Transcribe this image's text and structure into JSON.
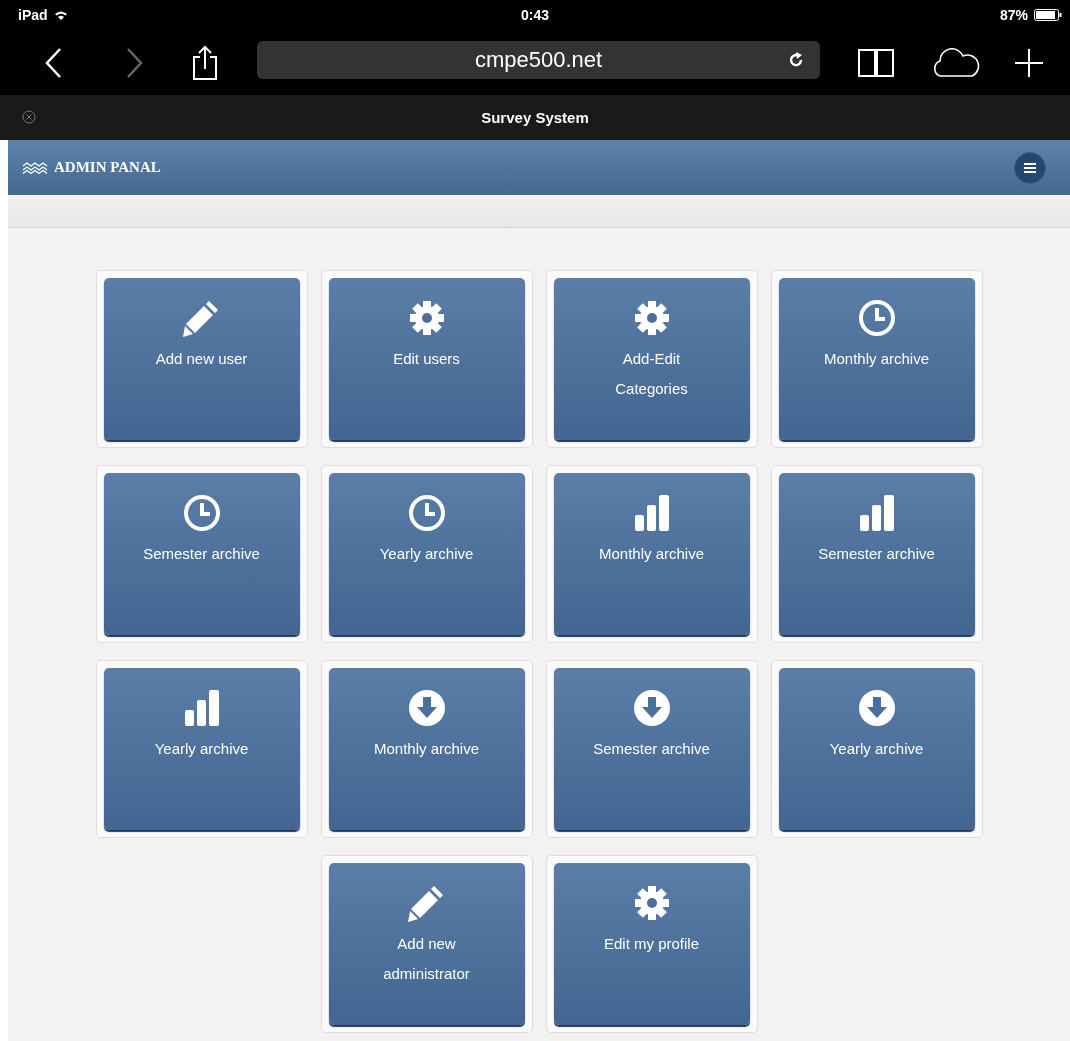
{
  "status_bar": {
    "device": "iPad",
    "time": "0:43",
    "battery": "87%"
  },
  "browser": {
    "url": "cmpe500.net",
    "tab_title": "Survey System"
  },
  "header": {
    "title": "ADMIN PANAL"
  },
  "tiles": [
    {
      "kind": "pencil",
      "label": "Add new user"
    },
    {
      "kind": "gear",
      "label": "Edit users"
    },
    {
      "kind": "gear",
      "label": "Add-Edit Categories"
    },
    {
      "kind": "clock",
      "label": "Monthly archive"
    },
    {
      "kind": "clock",
      "label": "Semester archive"
    },
    {
      "kind": "clock",
      "label": "Yearly archive"
    },
    {
      "kind": "bars",
      "label": "Monthly archive"
    },
    {
      "kind": "bars",
      "label": "Semester archive"
    },
    {
      "kind": "bars",
      "label": "Yearly archive"
    },
    {
      "kind": "download",
      "label": "Monthly archive"
    },
    {
      "kind": "download",
      "label": "Semester archive"
    },
    {
      "kind": "download",
      "label": "Yearly archive"
    },
    {
      "kind": "pencil",
      "label": "Add new administrator"
    },
    {
      "kind": "gear",
      "label": "Edit my profile"
    }
  ]
}
